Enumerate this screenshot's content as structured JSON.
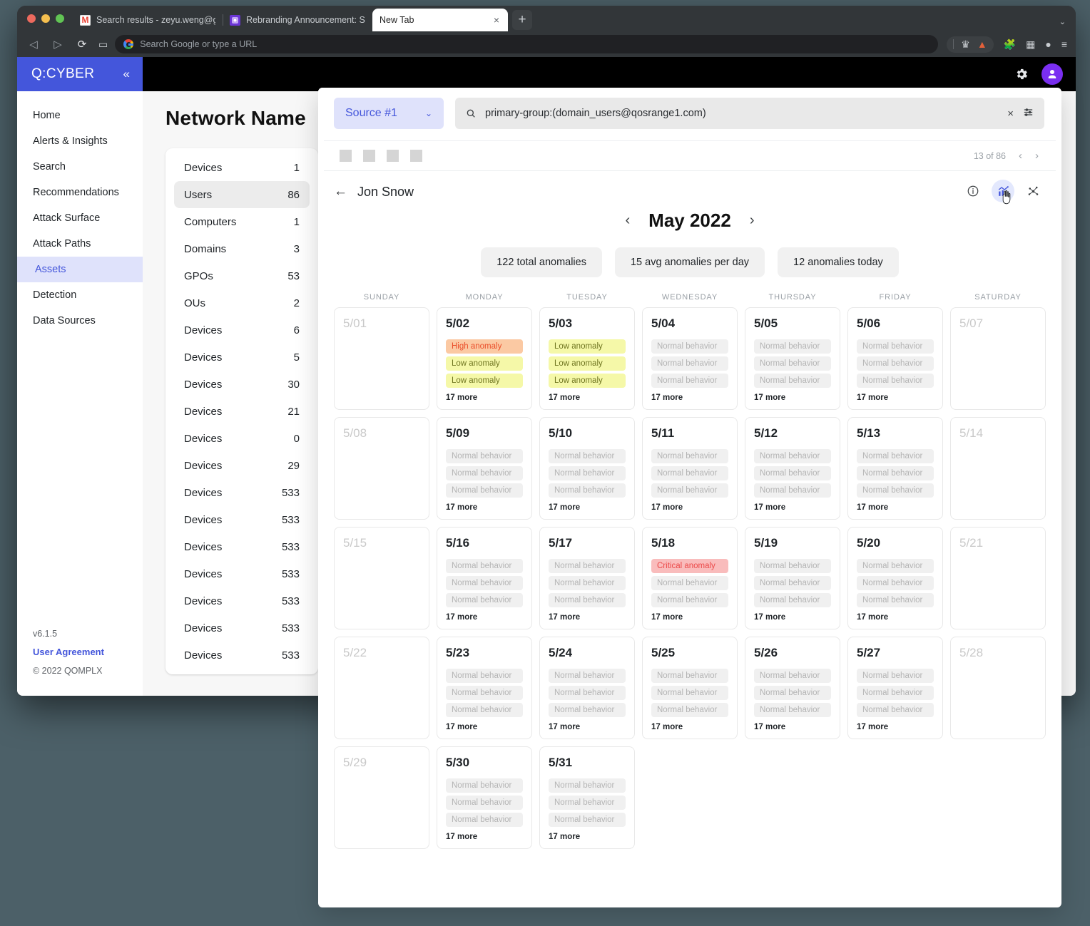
{
  "browser": {
    "tabs": [
      {
        "title": "Search results - zeyu.weng@gmail.c",
        "favicon": "gmail-icon",
        "active": false
      },
      {
        "title": "Rebranding Announcement: Survica",
        "favicon": "purple-app-icon",
        "active": false
      },
      {
        "title": "New Tab",
        "favicon": "none",
        "active": true
      }
    ],
    "new_tab_label": "+",
    "close_label": "×",
    "tab_list_caret": "⌄",
    "nav": {
      "back": "◁",
      "forward": "▷",
      "reload": "⟳",
      "bookmark": "▭"
    },
    "omnibox": {
      "placeholder": "Search Google or type a URL",
      "value": ""
    },
    "right_icons": [
      "brave-shield-icon",
      "triangle-icon",
      "extensions-puzzle-icon",
      "wallet-icon",
      "profile-icon",
      "menu-icon"
    ]
  },
  "app": {
    "brand": {
      "name": "Q:CYBER",
      "collapse": "«"
    },
    "topbar_icons": [
      "gear-icon",
      "user-avatar-icon"
    ],
    "sidebar": {
      "items": [
        {
          "label": "Home",
          "active": false
        },
        {
          "label": "Alerts & Insights",
          "active": false
        },
        {
          "label": "Search",
          "active": false
        },
        {
          "label": "Recommendations",
          "active": false
        },
        {
          "label": "Attack Surface",
          "active": false
        },
        {
          "label": "Attack Paths",
          "active": false
        },
        {
          "label": "Assets",
          "active": true
        },
        {
          "label": "Detection",
          "active": false
        },
        {
          "label": "Data Sources",
          "active": false
        }
      ],
      "footer": {
        "version": "v6.1.5",
        "agreement": "User Agreement",
        "copyright": "© 2022 QOMPLX"
      }
    },
    "network": {
      "title": "Network Name",
      "rows": [
        {
          "label": "Devices",
          "value": "1",
          "selected": false
        },
        {
          "label": "Users",
          "value": "86",
          "selected": true
        },
        {
          "label": "Computers",
          "value": "1",
          "selected": false
        },
        {
          "label": "Domains",
          "value": "3",
          "selected": false
        },
        {
          "label": "GPOs",
          "value": "53",
          "selected": false
        },
        {
          "label": "OUs",
          "value": "2",
          "selected": false
        },
        {
          "label": "Devices",
          "value": "6",
          "selected": false
        },
        {
          "label": "Devices",
          "value": "5",
          "selected": false
        },
        {
          "label": "Devices",
          "value": "30",
          "selected": false
        },
        {
          "label": "Devices",
          "value": "21",
          "selected": false
        },
        {
          "label": "Devices",
          "value": "0",
          "selected": false
        },
        {
          "label": "Devices",
          "value": "29",
          "selected": false
        },
        {
          "label": "Devices",
          "value": "533",
          "selected": false
        },
        {
          "label": "Devices",
          "value": "533",
          "selected": false
        },
        {
          "label": "Devices",
          "value": "533",
          "selected": false
        },
        {
          "label": "Devices",
          "value": "533",
          "selected": false
        },
        {
          "label": "Devices",
          "value": "533",
          "selected": false
        },
        {
          "label": "Devices",
          "value": "533",
          "selected": false
        },
        {
          "label": "Devices",
          "value": "533",
          "selected": false
        }
      ]
    },
    "search": {
      "source_label": "Source #1",
      "source_caret": "⌄",
      "query": "primary-group:(domain_users@qosrange1.com)",
      "placeholder": "Search",
      "clear_label": "×",
      "filter_icon": "filter-sliders-icon"
    },
    "toolbar": {
      "placeholder_count": 4,
      "pager_text": "13 of 86",
      "prev": "‹",
      "next": "›"
    },
    "detail": {
      "back": "←",
      "user_name": "Jon Snow",
      "view_icons": [
        {
          "name": "info-icon",
          "selected": false
        },
        {
          "name": "analytics-chart-icon",
          "selected": true
        },
        {
          "name": "network-graph-icon",
          "selected": false
        }
      ]
    },
    "calendar": {
      "month": "May 2022",
      "prev": "‹",
      "next": "›",
      "stats": [
        "122 total anomalies",
        "15 avg anomalies per day",
        "12 anomalies today"
      ],
      "dow": [
        "SUNDAY",
        "MONDAY",
        "TUESDAY",
        "WEDNESDAY",
        "THURSDAY",
        "FRIDAY",
        "SATURDAY"
      ],
      "more_label": "17 more",
      "event_labels": {
        "normal": "Normal behavior",
        "low": "Low anomaly",
        "high": "High anomaly",
        "critical": "Critical anomaly"
      },
      "weeks": [
        [
          {
            "date": "5/01",
            "muted": true,
            "events": [],
            "more": ""
          },
          {
            "date": "5/02",
            "muted": false,
            "events": [
              "high",
              "low",
              "low"
            ],
            "more": "17 more"
          },
          {
            "date": "5/03",
            "muted": false,
            "events": [
              "low",
              "low",
              "low"
            ],
            "more": "17 more"
          },
          {
            "date": "5/04",
            "muted": false,
            "events": [
              "normal",
              "normal",
              "normal"
            ],
            "more": "17 more"
          },
          {
            "date": "5/05",
            "muted": false,
            "events": [
              "normal",
              "normal",
              "normal"
            ],
            "more": "17 more"
          },
          {
            "date": "5/06",
            "muted": false,
            "events": [
              "normal",
              "normal",
              "normal"
            ],
            "more": "17 more"
          },
          {
            "date": "5/07",
            "muted": true,
            "events": [],
            "more": ""
          }
        ],
        [
          {
            "date": "5/08",
            "muted": true,
            "events": [],
            "more": ""
          },
          {
            "date": "5/09",
            "muted": false,
            "events": [
              "normal",
              "normal",
              "normal"
            ],
            "more": "17 more"
          },
          {
            "date": "5/10",
            "muted": false,
            "events": [
              "normal",
              "normal",
              "normal"
            ],
            "more": "17 more"
          },
          {
            "date": "5/11",
            "muted": false,
            "events": [
              "normal",
              "normal",
              "normal"
            ],
            "more": "17 more"
          },
          {
            "date": "5/12",
            "muted": false,
            "events": [
              "normal",
              "normal",
              "normal"
            ],
            "more": "17 more"
          },
          {
            "date": "5/13",
            "muted": false,
            "events": [
              "normal",
              "normal",
              "normal"
            ],
            "more": "17 more"
          },
          {
            "date": "5/14",
            "muted": true,
            "events": [],
            "more": ""
          }
        ],
        [
          {
            "date": "5/15",
            "muted": true,
            "events": [],
            "more": ""
          },
          {
            "date": "5/16",
            "muted": false,
            "events": [
              "normal",
              "normal",
              "normal"
            ],
            "more": "17 more"
          },
          {
            "date": "5/17",
            "muted": false,
            "events": [
              "normal",
              "normal",
              "normal"
            ],
            "more": "17 more"
          },
          {
            "date": "5/18",
            "muted": false,
            "events": [
              "critical",
              "normal",
              "normal"
            ],
            "more": "17 more"
          },
          {
            "date": "5/19",
            "muted": false,
            "events": [
              "normal",
              "normal",
              "normal"
            ],
            "more": "17 more"
          },
          {
            "date": "5/20",
            "muted": false,
            "events": [
              "normal",
              "normal",
              "normal"
            ],
            "more": "17 more"
          },
          {
            "date": "5/21",
            "muted": true,
            "events": [],
            "more": ""
          }
        ],
        [
          {
            "date": "5/22",
            "muted": true,
            "events": [],
            "more": ""
          },
          {
            "date": "5/23",
            "muted": false,
            "events": [
              "normal",
              "normal",
              "normal"
            ],
            "more": "17 more"
          },
          {
            "date": "5/24",
            "muted": false,
            "events": [
              "normal",
              "normal",
              "normal"
            ],
            "more": "17 more"
          },
          {
            "date": "5/25",
            "muted": false,
            "events": [
              "normal",
              "normal",
              "normal"
            ],
            "more": "17 more"
          },
          {
            "date": "5/26",
            "muted": false,
            "events": [
              "normal",
              "normal",
              "normal"
            ],
            "more": "17 more"
          },
          {
            "date": "5/27",
            "muted": false,
            "events": [
              "normal",
              "normal",
              "normal"
            ],
            "more": "17 more"
          },
          {
            "date": "5/28",
            "muted": true,
            "events": [],
            "more": ""
          }
        ],
        [
          {
            "date": "5/29",
            "muted": true,
            "events": [],
            "more": ""
          },
          {
            "date": "5/30",
            "muted": false,
            "events": [
              "normal",
              "normal",
              "normal"
            ],
            "more": "17 more"
          },
          {
            "date": "5/31",
            "muted": false,
            "events": [
              "normal",
              "normal",
              "normal"
            ],
            "more": "17 more"
          }
        ]
      ]
    }
  },
  "colors": {
    "brand": "#4456db",
    "accent_bg": "#dfe2fb",
    "low": "#f5f8a8",
    "high": "#fbc9a3",
    "critical": "#f9bcbc",
    "normal": "#f0f0f0"
  }
}
